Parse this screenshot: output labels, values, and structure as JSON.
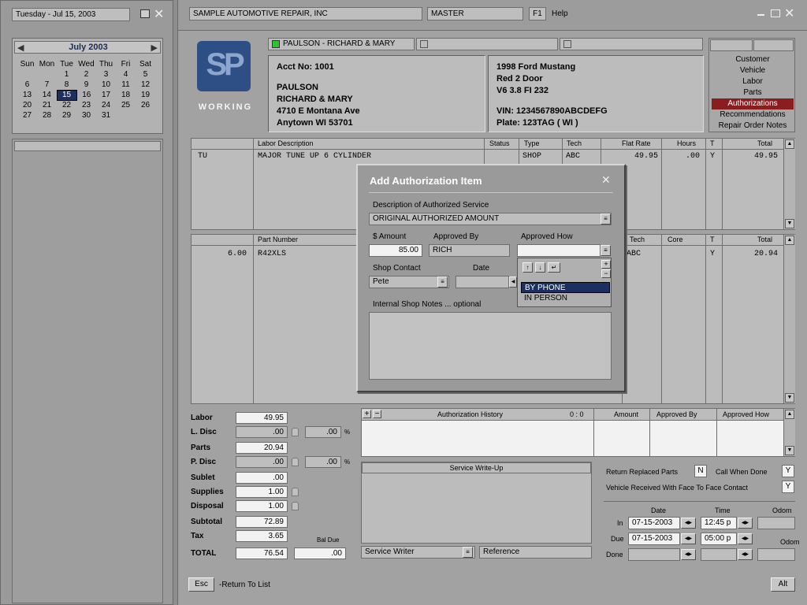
{
  "left": {
    "date_bar": "Tuesday - Jul 15, 2003",
    "calendar": {
      "month": "July 2003",
      "weekdays": [
        "Sun",
        "Mon",
        "Tue",
        "Wed",
        "Thu",
        "Fri",
        "Sat"
      ],
      "weeks": [
        [
          "",
          "",
          "1",
          "2",
          "3",
          "4",
          "5"
        ],
        [
          "6",
          "7",
          "8",
          "9",
          "10",
          "11",
          "12"
        ],
        [
          "13",
          "14",
          "15",
          "16",
          "17",
          "18",
          "19"
        ],
        [
          "20",
          "21",
          "22",
          "23",
          "24",
          "25",
          "26"
        ],
        [
          "27",
          "28",
          "29",
          "30",
          "31",
          "",
          ""
        ]
      ],
      "selected": "15"
    }
  },
  "titlebar": {
    "shop": "SAMPLE AUTOMOTIVE REPAIR, INC",
    "user": "MASTER",
    "f1": "F1",
    "help": "Help"
  },
  "logo": {
    "text": "SP",
    "status": "WORKING"
  },
  "customer_tab": "PAULSON - RICHARD & MARY",
  "customer": {
    "acct": "Acct No:  1001",
    "last": "PAULSON",
    "first": "RICHARD & MARY",
    "street": "4710 E Montana Ave",
    "city": "Anytown  WI  53701"
  },
  "vehicle": {
    "line1": "1998  Ford  Mustang",
    "line2": "Red  2 Door",
    "line3": "V6 3.8 FI  232",
    "vin": "VIN:  1234567890ABCDEFG",
    "plate": "Plate:  123TAG  ( WI )"
  },
  "nav": {
    "items": [
      "Customer",
      "Vehicle",
      "Labor",
      "Parts",
      "Authorizations",
      "Recommendations",
      "Repair Order Notes"
    ],
    "active": "Authorizations"
  },
  "labor": {
    "headers": [
      "Labor Description",
      "Status",
      "Type",
      "Tech",
      "Flat Rate",
      "Hours",
      "T",
      "Total"
    ],
    "rows": [
      {
        "code": "TU",
        "desc": "MAJOR TUNE UP 6 CYLINDER",
        "status": "",
        "type": "SHOP",
        "tech": "ABC",
        "rate": "49.95",
        "hours": ".00",
        "t": "Y",
        "total": "49.95"
      }
    ]
  },
  "parts": {
    "headers": [
      "Part Number",
      "Tech",
      "Core",
      "T",
      "Total"
    ],
    "rows": [
      {
        "qty": "6.00",
        "part": "R42XLS",
        "tech": "ABC",
        "core": "",
        "t": "Y",
        "total": "20.94"
      }
    ]
  },
  "totals": {
    "labor_lbl": "Labor",
    "labor": "49.95",
    "ldisc_lbl": "L. Disc",
    "ldisc": ".00",
    "ldisc_pct": ".00",
    "parts_lbl": "Parts",
    "parts": "20.94",
    "pdisc_lbl": "P. Disc",
    "pdisc": ".00",
    "pdisc_pct": ".00",
    "sublet_lbl": "Sublet",
    "sublet": ".00",
    "supplies_lbl": "Supplies",
    "supplies": "1.00",
    "disposal_lbl": "Disposal",
    "disposal": "1.00",
    "subtotal_lbl": "Subtotal",
    "subtotal": "72.89",
    "tax_lbl": "Tax",
    "tax": "3.65",
    "baldue_lbl": "Bal Due",
    "total_lbl": "TOTAL",
    "total": "76.54",
    "baldue": ".00",
    "pct": "%"
  },
  "auth_history": {
    "title": "Authorization  History",
    "count": "0 : 0",
    "headers": [
      "Amount",
      "Approved By",
      "Approved How"
    ]
  },
  "writeup": {
    "title": "Service  Write-Up",
    "writer": "Service Writer",
    "reference": "Reference"
  },
  "options": {
    "return_parts": "Return Replaced Parts",
    "return_parts_val": "N",
    "call_done": "Call When Done",
    "call_done_val": "Y",
    "face": "Vehicle Received With Face To Face Contact",
    "face_val": "Y"
  },
  "schedule": {
    "date_hdr": "Date",
    "time_hdr": "Time",
    "odom_hdr": "Odom",
    "in_lbl": "In",
    "in_date": "07-15-2003",
    "in_time": "12:45 p",
    "due_lbl": "Due",
    "due_date": "07-15-2003",
    "due_time": "05:00 p",
    "done_lbl": "Done"
  },
  "footer": {
    "esc": "Esc",
    "return": "-Return To List",
    "alt": "Alt"
  },
  "dialog": {
    "title": "Add Authorization Item",
    "desc_lbl": "Description of Authorized Service",
    "desc": "ORIGINAL AUTHORIZED AMOUNT",
    "amount_lbl": "$ Amount",
    "amount": "85.00",
    "by_lbl": "Approved By",
    "by": "RICH",
    "how_lbl": "Approved How",
    "contact_lbl": "Shop Contact",
    "contact": "Pete",
    "date_lbl": "Date",
    "notes_lbl": "Internal Shop Notes ... optional",
    "options": [
      "BY PHONE",
      "IN PERSON"
    ],
    "selected": "BY PHONE"
  }
}
